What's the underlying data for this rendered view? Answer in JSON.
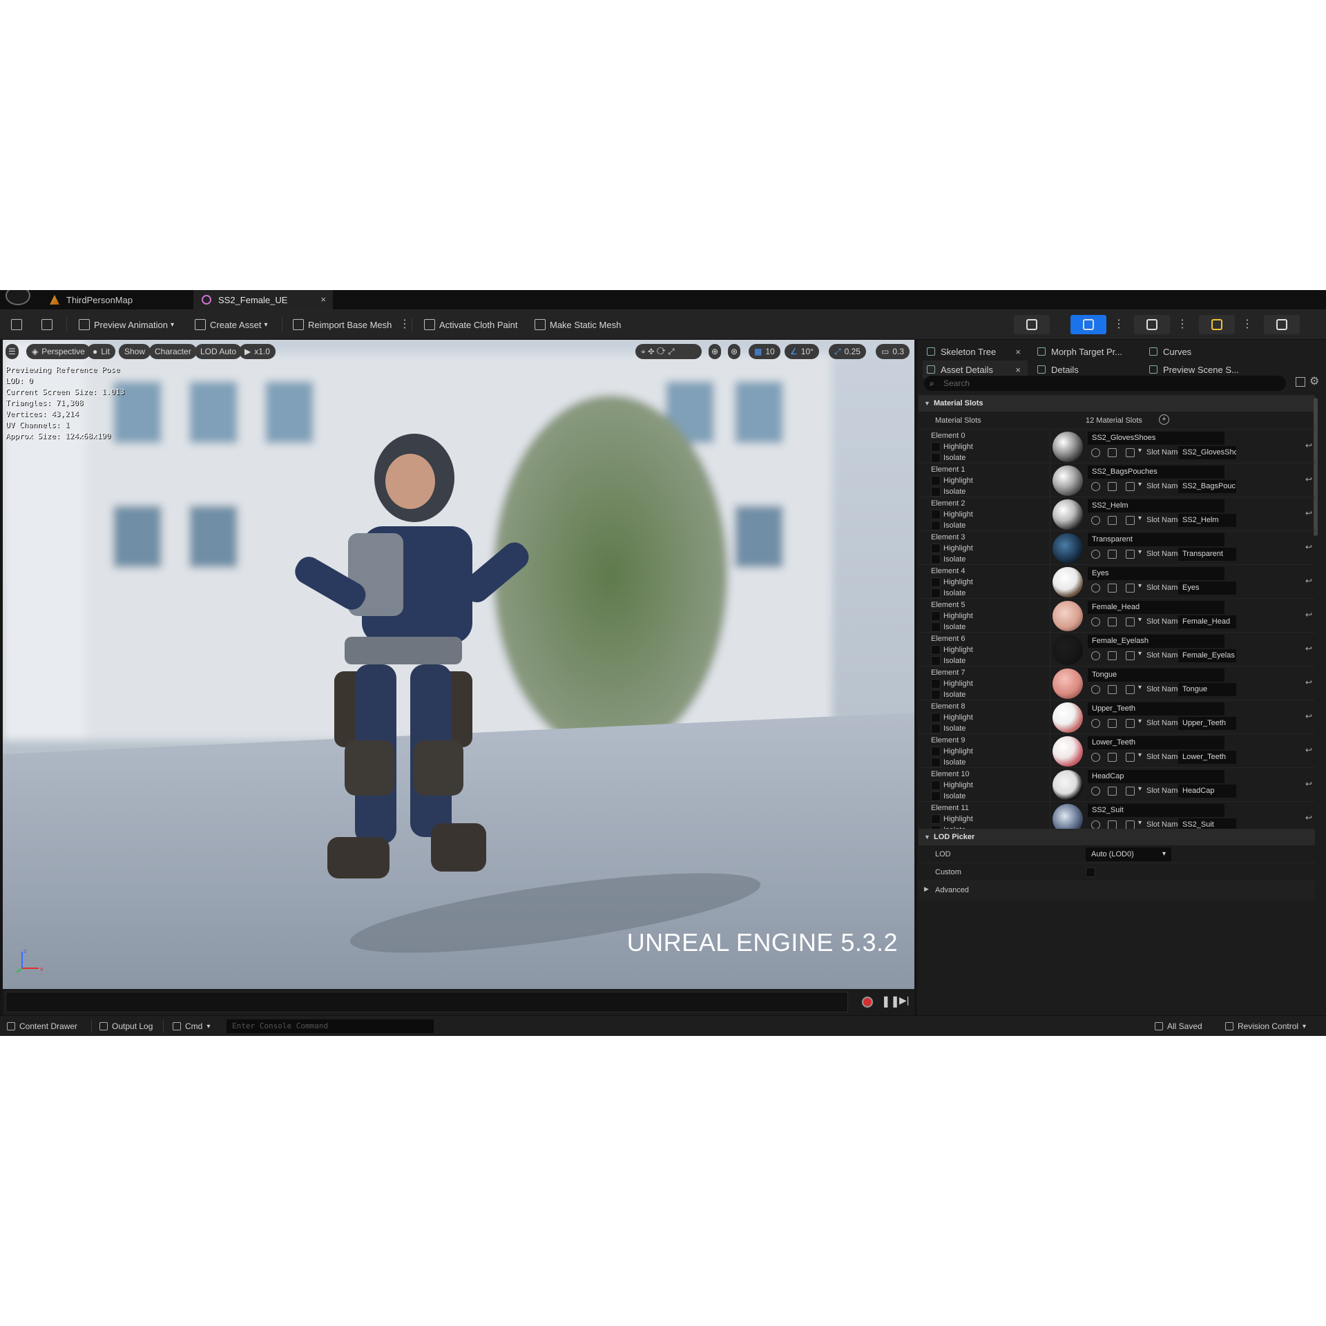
{
  "tabs": [
    {
      "label": "ThirdPersonMap",
      "icon": "level-icon"
    },
    {
      "label": "SS2_Female_UE",
      "icon": "skeletal-mesh-icon",
      "close": "×"
    }
  ],
  "toolbar": {
    "preview_animation": "Preview Animation",
    "create_asset": "Create Asset",
    "reimport_base_mesh": "Reimport Base Mesh",
    "activate_cloth_paint": "Activate Cloth Paint",
    "make_static_mesh": "Make Static Mesh"
  },
  "viewport": {
    "perspective": "Perspective",
    "lit": "Lit",
    "show": "Show",
    "character": "Character",
    "lod": "LOD Auto",
    "speed": "x1.0",
    "grid_snap": "10",
    "rot_snap": "10°",
    "scale_snap": "0.25",
    "cam_speed": "0.3",
    "stats": [
      "Previewing Reference Pose",
      "LOD: 0",
      "Current Screen Size: 1.013",
      "Triangles: 71,308",
      "Vertices: 43,214",
      "UV Channels: 1",
      "Approx Size: 124x68x190"
    ],
    "watermark": "UNREAL ENGINE 5.3.2"
  },
  "panel_tabs": {
    "skeleton_tree": "Skeleton Tree",
    "morph_target": "Morph Target Pr...",
    "curves": "Curves",
    "asset_details": "Asset Details",
    "details": "Details",
    "preview_scene": "Preview Scene S...",
    "close": "×"
  },
  "details": {
    "search_placeholder": "Search",
    "material_slots_section": "Material Slots",
    "material_slots_label": "Material Slots",
    "material_slots_count": "12 Material Slots",
    "highlight": "Highlight",
    "isolate": "Isolate",
    "slot_name_label": "Slot Name",
    "elements": [
      {
        "label": "Element 0",
        "material": "SS2_GlovesShoes",
        "slot": "SS2_GlovesSho"
      },
      {
        "label": "Element 1",
        "material": "SS2_BagsPouches",
        "slot": "SS2_BagsPouc"
      },
      {
        "label": "Element 2",
        "material": "SS2_Helm",
        "slot": "SS2_Helm"
      },
      {
        "label": "Element 3",
        "material": "Transparent",
        "slot": "Transparent"
      },
      {
        "label": "Element 4",
        "material": "Eyes",
        "slot": "Eyes"
      },
      {
        "label": "Element 5",
        "material": "Female_Head",
        "slot": "Female_Head"
      },
      {
        "label": "Element 6",
        "material": "Female_Eyelash",
        "slot": "Female_Eyelas"
      },
      {
        "label": "Element 7",
        "material": "Tongue",
        "slot": "Tongue"
      },
      {
        "label": "Element 8",
        "material": "Upper_Teeth",
        "slot": "Upper_Teeth"
      },
      {
        "label": "Element 9",
        "material": "Lower_Teeth",
        "slot": "Lower_Teeth"
      },
      {
        "label": "Element 10",
        "material": "HeadCap",
        "slot": "HeadCap"
      },
      {
        "label": "Element 11",
        "material": "SS2_Suit",
        "slot": "SS2_Suit"
      }
    ],
    "lod_section": "LOD Picker",
    "lod_label": "LOD",
    "lod_value": "Auto (LOD0)",
    "custom_label": "Custom",
    "advanced": "Advanced"
  },
  "statusbar": {
    "content_drawer": "Content Drawer",
    "output_log": "Output Log",
    "cmd": "Cmd",
    "console_placeholder": "Enter Console Command",
    "all_saved": "All Saved",
    "revision_control": "Revision Control"
  },
  "colors": {
    "accent": "#1a73e8",
    "panel_bg": "#1c1c1c",
    "toolbar_bg": "#242424",
    "record": "#d23030"
  }
}
